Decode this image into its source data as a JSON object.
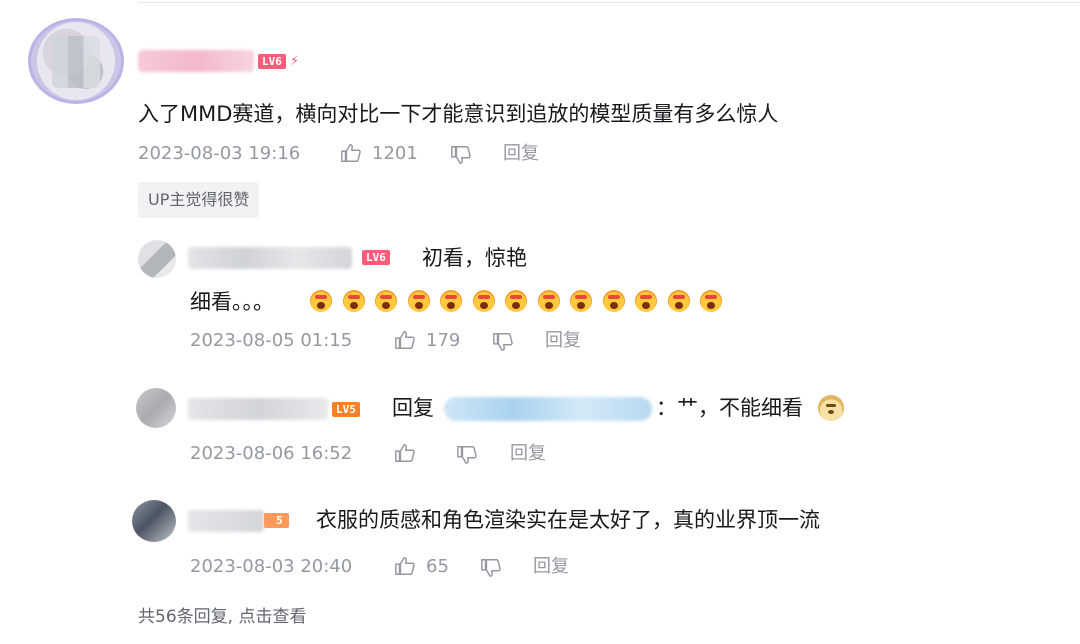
{
  "colors": {
    "text": "#18191c",
    "meta": "#9499a0",
    "badge_lv6": "#ff5c7c",
    "badge_lv5": "#ff7f24",
    "tag_bg": "#f1f2f3"
  },
  "main_comment": {
    "level_badge": "LV6",
    "text": "入了MMD赛道，横向对比一下才能意识到追放的模型质量有多么惊人",
    "time": "2023-08-03 19:16",
    "likes": "1201",
    "reply_label": "回复",
    "up_tag": "UP主觉得很赞"
  },
  "replies": [
    {
      "level_badge": "LV6",
      "text_line1": "初看，惊艳",
      "text_line2": "细看。。。",
      "time": "2023-08-05 01:15",
      "likes": "179",
      "reply_label": "回复",
      "emoji_count": 13,
      "emoji_name": "scared-face-emoji"
    },
    {
      "level_badge": "LV5",
      "reply_prefix": "回复",
      "text": "：艹，不能细看",
      "time": "2023-08-06 16:52",
      "likes": "",
      "reply_label": "回复",
      "emoji_name": "doge-emoji"
    },
    {
      "level_badge": "5",
      "text": "衣服的质感和角色渲染实在是太好了，真的业界顶一流",
      "time": "2023-08-03 20:40",
      "likes": "65",
      "reply_label": "回复"
    }
  ],
  "footer": {
    "more_replies": "共56条回复, 点击查看"
  },
  "icons": {
    "like": "thumb-up-icon",
    "dislike": "thumb-down-icon"
  }
}
